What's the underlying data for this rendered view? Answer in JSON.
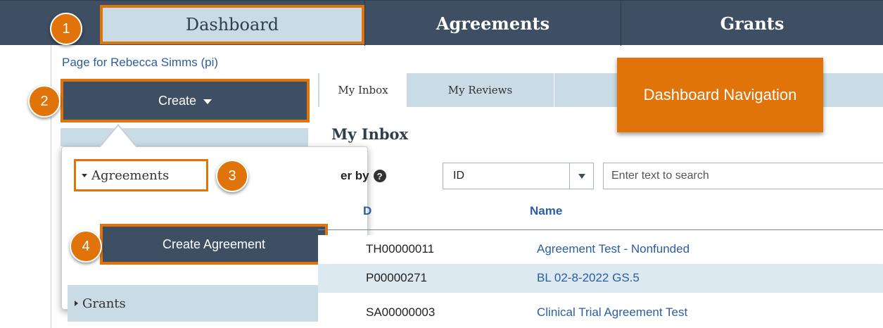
{
  "topnav": {
    "items": [
      {
        "label": "Dashboard"
      },
      {
        "label": "Agreements"
      },
      {
        "label": "Grants"
      }
    ]
  },
  "sidebar": {
    "page_for": "Page for Rebecca Simms (pi)",
    "create_label": "Create"
  },
  "dropdown": {
    "section_agreements": "Agreements",
    "create_agreement": "Create Agreement",
    "section_grants": "Grants"
  },
  "steps": [
    "1",
    "2",
    "3",
    "4"
  ],
  "callout": "Dashboard Navigation",
  "tabs": [
    {
      "label": "My Inbox",
      "active": true
    },
    {
      "label": "My Reviews",
      "active": false
    }
  ],
  "inbox": {
    "title": "My Inbox",
    "filter_label": "er by",
    "filter_value": "ID",
    "search_placeholder": "Enter text to search",
    "columns": [
      "D",
      "Name"
    ],
    "rows": [
      {
        "id": "TH00000011",
        "name": "Agreement Test - Nonfunded"
      },
      {
        "id": "P00000271",
        "name": "BL 02-8-2022 GS.5"
      },
      {
        "id": "SA00000003",
        "name": "Clinical Trial Agreement Test"
      }
    ]
  },
  "colors": {
    "nav_bg": "#3e4f63",
    "highlight": "#e07309",
    "light_band": "#c9dbe5",
    "link": "#2b5e9e"
  }
}
